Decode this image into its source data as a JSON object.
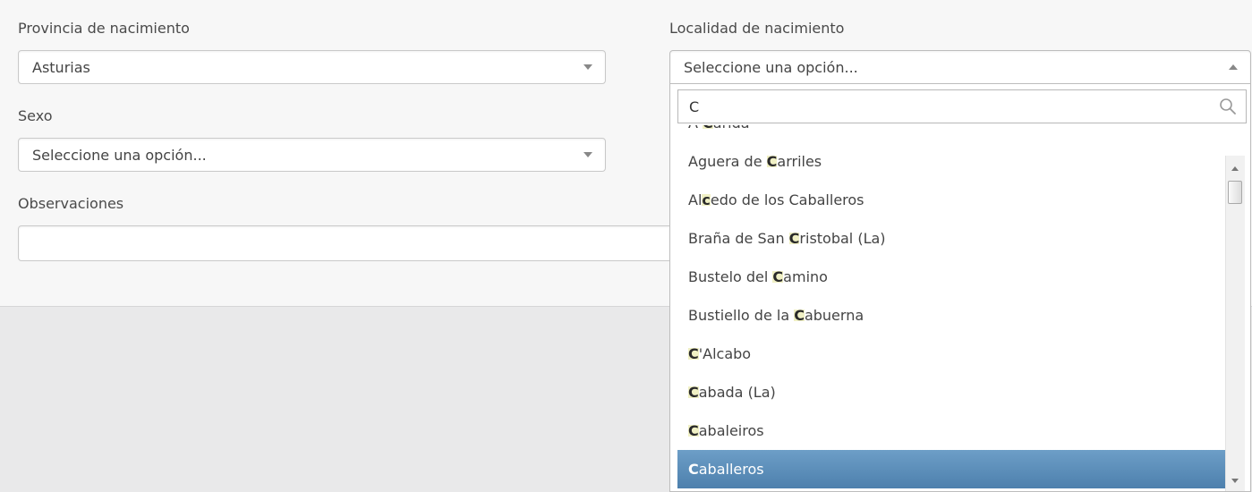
{
  "form": {
    "provincia": {
      "label": "Provincia de nacimiento",
      "value": "Asturias"
    },
    "sexo": {
      "label": "Sexo",
      "value": "Seleccione una opción..."
    },
    "observaciones": {
      "label": "Observaciones",
      "value": ""
    },
    "localidad": {
      "label": "Localidad de nacimiento",
      "value": "Seleccione una opción..."
    }
  },
  "dropdown": {
    "search_value": "C",
    "search_icon": "search-icon",
    "results": [
      {
        "pre": "A ",
        "match": "C",
        "post": "arida"
      },
      {
        "pre": "Aguera de ",
        "match": "C",
        "post": "arriles"
      },
      {
        "pre": "Al",
        "match": "c",
        "post": "edo de los Caballeros"
      },
      {
        "pre": "Braña de San ",
        "match": "C",
        "post": "ristobal (La)"
      },
      {
        "pre": "Bustelo del ",
        "match": "C",
        "post": "amino"
      },
      {
        "pre": "Bustiello de la ",
        "match": "C",
        "post": "abuerna"
      },
      {
        "pre": "",
        "match": "C",
        "post": "'Alcabo"
      },
      {
        "pre": "",
        "match": "C",
        "post": "abada (La)"
      },
      {
        "pre": "",
        "match": "C",
        "post": "abaleiros"
      },
      {
        "pre": "",
        "match": "C",
        "post": "aballeros"
      }
    ],
    "active_index": 9
  },
  "colors": {
    "highlight": "#f0f0c4",
    "active_item": "#5a8cb8"
  }
}
